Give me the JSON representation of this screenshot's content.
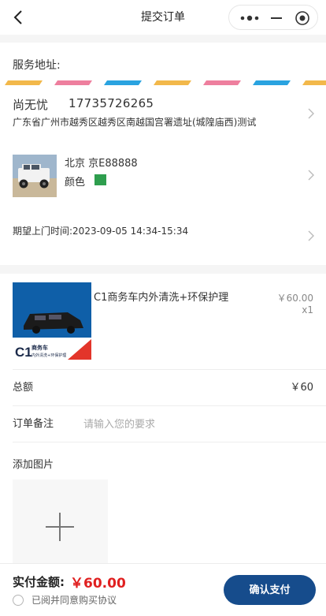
{
  "nav": {
    "title": "提交订单"
  },
  "address": {
    "section_title": "服务地址:",
    "name": "尚无忧",
    "phone": "17735726265",
    "detail": "广东省广州市越秀区越秀区南越国宫署遗址(城隍庙西)测试"
  },
  "car": {
    "plate": "北京 京E88888",
    "color_label": "颜色",
    "color_value": "#2e9e4e"
  },
  "appointment": {
    "text": "期望上门时间:2023-09-05 14:34-15:34"
  },
  "product": {
    "image_label": "C1",
    "image_sub1": "商务车",
    "image_sub2": "内外清洗+环保护理",
    "name": "C1商务车内外清洗+环保护理",
    "price": "￥60.00",
    "qty": "x1"
  },
  "summary": {
    "total_label": "总额",
    "total_value": "￥60",
    "remark_label": "订单备注",
    "remark_placeholder": "请输入您的要求",
    "remark_value": ""
  },
  "images": {
    "title": "添加图片"
  },
  "footer": {
    "pay_label": "实付金额:",
    "pay_amount": "￥60.00",
    "agreement": "已阅并同意购买协议",
    "confirm_label": "确认支付"
  },
  "colors": {
    "accent": "#164c8c",
    "price_red": "#e02020",
    "stripe": [
      "#f2b84b",
      "#ee7f9e",
      "#2aa3e0"
    ]
  }
}
